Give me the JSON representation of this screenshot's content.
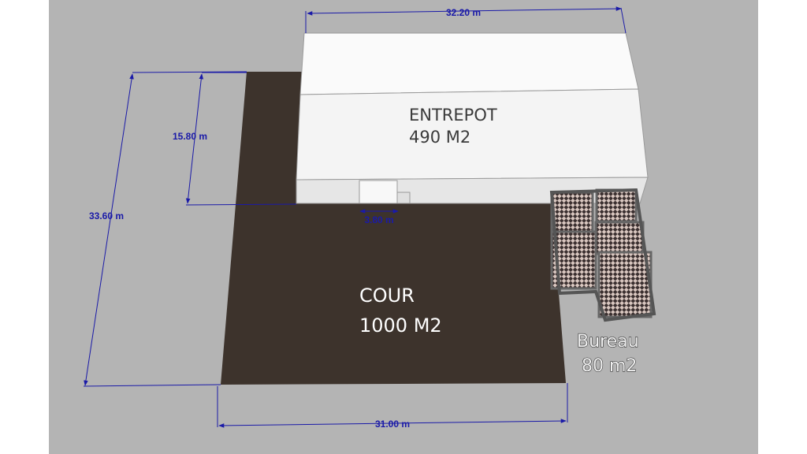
{
  "dimensions": {
    "top_width": "32.20 m",
    "left_total": "33.60 m",
    "left_warehouse": "15.80 m",
    "door_width": "3.80 m",
    "bottom_width": "31.00 m"
  },
  "zones": {
    "warehouse": {
      "name": "ENTREPOT",
      "area": "490 M2"
    },
    "yard": {
      "name": "COUR",
      "area": "1000 M2"
    },
    "office": {
      "name": "Bureau",
      "area": "80 m2"
    }
  },
  "colors": {
    "background": "#ffffff",
    "canvas": "#b4b4b4",
    "yard": "#3d332c",
    "warehouse_roof": "#fafafa",
    "warehouse_front": "#ebebeb",
    "dimension": "#1a1aa8"
  }
}
